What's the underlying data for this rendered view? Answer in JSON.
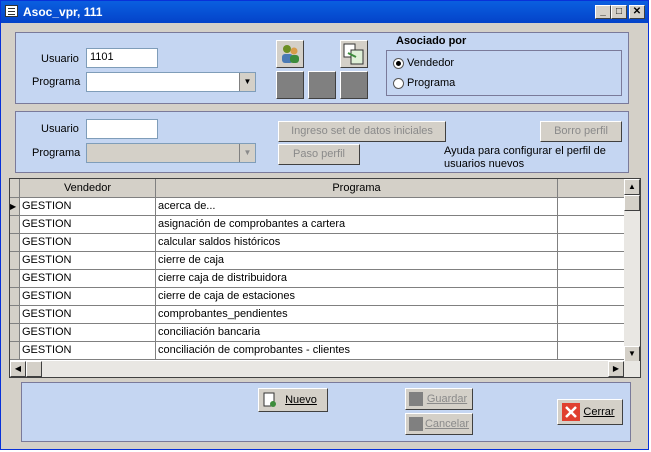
{
  "window": {
    "title": "Asoc_vpr, 111"
  },
  "top_panel": {
    "usuario_label": "Usuario",
    "usuario_value": "1101",
    "programa_label": "Programa",
    "programa_value": "",
    "asociado": {
      "label": "Asociado por",
      "options": [
        "Vendedor",
        "Programa"
      ],
      "selected": "Vendedor"
    }
  },
  "mid_panel": {
    "usuario_label": "Usuario",
    "usuario_value": "",
    "programa_label": "Programa",
    "programa_value": "",
    "ingreso_button": "Ingreso set de datos iniciales",
    "borro_button": "Borro perfil",
    "paso_button": "Paso perfil",
    "help_line1": "Ayuda para configurar el perfil de",
    "help_line2": "usuarios nuevos"
  },
  "grid": {
    "columns": [
      "Vendedor",
      "Programa"
    ],
    "rows": [
      [
        "GESTION",
        "acerca de..."
      ],
      [
        "GESTION",
        "asignación de comprobantes a cartera"
      ],
      [
        "GESTION",
        "calcular saldos históricos"
      ],
      [
        "GESTION",
        "cierre de caja"
      ],
      [
        "GESTION",
        "cierre caja de distribuidora"
      ],
      [
        "GESTION",
        "cierre de caja de estaciones"
      ],
      [
        "GESTION",
        "comprobantes_pendientes"
      ],
      [
        "GESTION",
        "conciliación bancaria"
      ],
      [
        "GESTION",
        "conciliación de comprobantes - clientes"
      ]
    ]
  },
  "buttons": {
    "nuevo": "Nuevo",
    "guardar": "Guardar",
    "cancelar": "Cancelar",
    "cerrar": "Cerrar"
  }
}
